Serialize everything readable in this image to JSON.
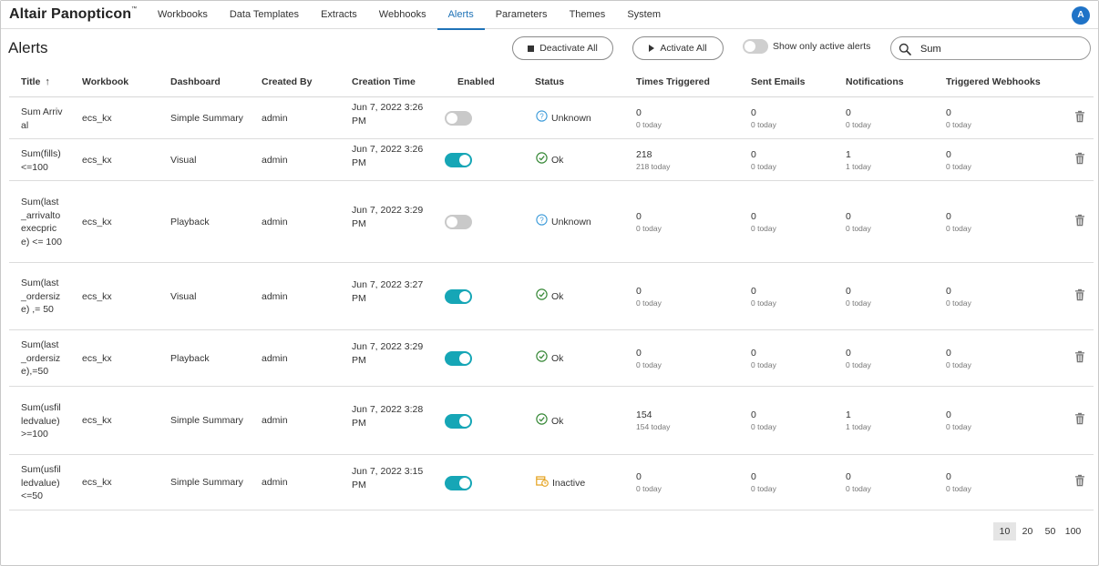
{
  "app": {
    "logo": "Altair Panopticon",
    "logo_mark": "™",
    "avatar_initial": "A",
    "accent": "#1f73b7",
    "toggle_on_color": "#16a6b6"
  },
  "nav": {
    "items": [
      {
        "label": "Workbooks"
      },
      {
        "label": "Data Templates"
      },
      {
        "label": "Extracts"
      },
      {
        "label": "Webhooks"
      },
      {
        "label": "Alerts",
        "active": true
      },
      {
        "label": "Parameters"
      },
      {
        "label": "Themes"
      },
      {
        "label": "System"
      }
    ]
  },
  "toolbar": {
    "title": "Alerts",
    "deactivate_label": "Deactivate All",
    "activate_label": "Activate All",
    "filter_label": "Show only active alerts",
    "filter_on": false,
    "search_value": "Sum"
  },
  "table": {
    "headers": {
      "title": "Title",
      "workbook": "Workbook",
      "dashboard": "Dashboard",
      "created_by": "Created By",
      "creation_time": "Creation Time",
      "enabled": "Enabled",
      "status": "Status",
      "times_triggered": "Times Triggered",
      "sent_emails": "Sent Emails",
      "notifications": "Notifications",
      "triggered_webhooks": "Triggered Webhooks"
    },
    "sort_icon": "arrow-up-icon",
    "rows": [
      {
        "title": "Sum Arrival",
        "workbook": "ecs_kx",
        "dashboard": "Simple Summary",
        "created_by": "admin",
        "time": "Jun 7, 2022 3:26 PM",
        "enabled": false,
        "status": "Unknown",
        "status_icon": "question-circle-icon",
        "tt": "0",
        "tt_today": "0 today",
        "se": "0",
        "se_today": "0 today",
        "no": "0",
        "no_today": "0 today",
        "tw": "0",
        "tw_today": "0 today"
      },
      {
        "title": "Sum(fills)<=100",
        "workbook": "ecs_kx",
        "dashboard": "Visual",
        "created_by": "admin",
        "time": "Jun 7, 2022 3:26 PM",
        "enabled": true,
        "status": "Ok",
        "status_icon": "check-circle-icon",
        "tt": "218",
        "tt_today": "218 today",
        "se": "0",
        "se_today": "0 today",
        "no": "1",
        "no_today": "1 today",
        "tw": "0",
        "tw_today": "0 today"
      },
      {
        "title": "Sum(last_arrivaltoexecprice) <= 100",
        "workbook": "ecs_kx",
        "dashboard": "Playback",
        "created_by": "admin",
        "time": "Jun 7, 2022 3:29 PM",
        "enabled": false,
        "status": "Unknown",
        "status_icon": "question-circle-icon",
        "tt": "0",
        "tt_today": "0 today",
        "se": "0",
        "se_today": "0 today",
        "no": "0",
        "no_today": "0 today",
        "tw": "0",
        "tw_today": "0 today"
      },
      {
        "title": "Sum(last_ordersize) ,= 50",
        "workbook": "ecs_kx",
        "dashboard": "Visual",
        "created_by": "admin",
        "time": "Jun 7, 2022 3:27 PM",
        "enabled": true,
        "status": "Ok",
        "status_icon": "check-circle-icon",
        "tt": "0",
        "tt_today": "0 today",
        "se": "0",
        "se_today": "0 today",
        "no": "0",
        "no_today": "0 today",
        "tw": "0",
        "tw_today": "0 today"
      },
      {
        "title": "Sum(last_ordersize),=50",
        "workbook": "ecs_kx",
        "dashboard": "Playback",
        "created_by": "admin",
        "time": "Jun 7, 2022 3:29 PM",
        "enabled": true,
        "status": "Ok",
        "status_icon": "check-circle-icon",
        "tt": "0",
        "tt_today": "0 today",
        "se": "0",
        "se_today": "0 today",
        "no": "0",
        "no_today": "0 today",
        "tw": "0",
        "tw_today": "0 today"
      },
      {
        "title": "Sum(usfilledvalue) >=100",
        "workbook": "ecs_kx",
        "dashboard": "Simple Summary",
        "created_by": "admin",
        "time": "Jun 7, 2022 3:28 PM",
        "enabled": true,
        "status": "Ok",
        "status_icon": "check-circle-icon",
        "tt": "154",
        "tt_today": "154 today",
        "se": "0",
        "se_today": "0 today",
        "no": "1",
        "no_today": "1 today",
        "tw": "0",
        "tw_today": "0 today"
      },
      {
        "title": "Sum(usfilledvalue)<=50",
        "workbook": "ecs_kx",
        "dashboard": "Simple Summary",
        "created_by": "admin",
        "time": "Jun 7, 2022 3:15 PM",
        "enabled": true,
        "status": "Inactive",
        "status_icon": "calendar-clock-icon",
        "tt": "0",
        "tt_today": "0 today",
        "se": "0",
        "se_today": "0 today",
        "no": "0",
        "no_today": "0 today",
        "tw": "0",
        "tw_today": "0 today"
      }
    ]
  },
  "pagination": {
    "sizes": [
      "10",
      "20",
      "50",
      "100"
    ],
    "selected": "10"
  }
}
